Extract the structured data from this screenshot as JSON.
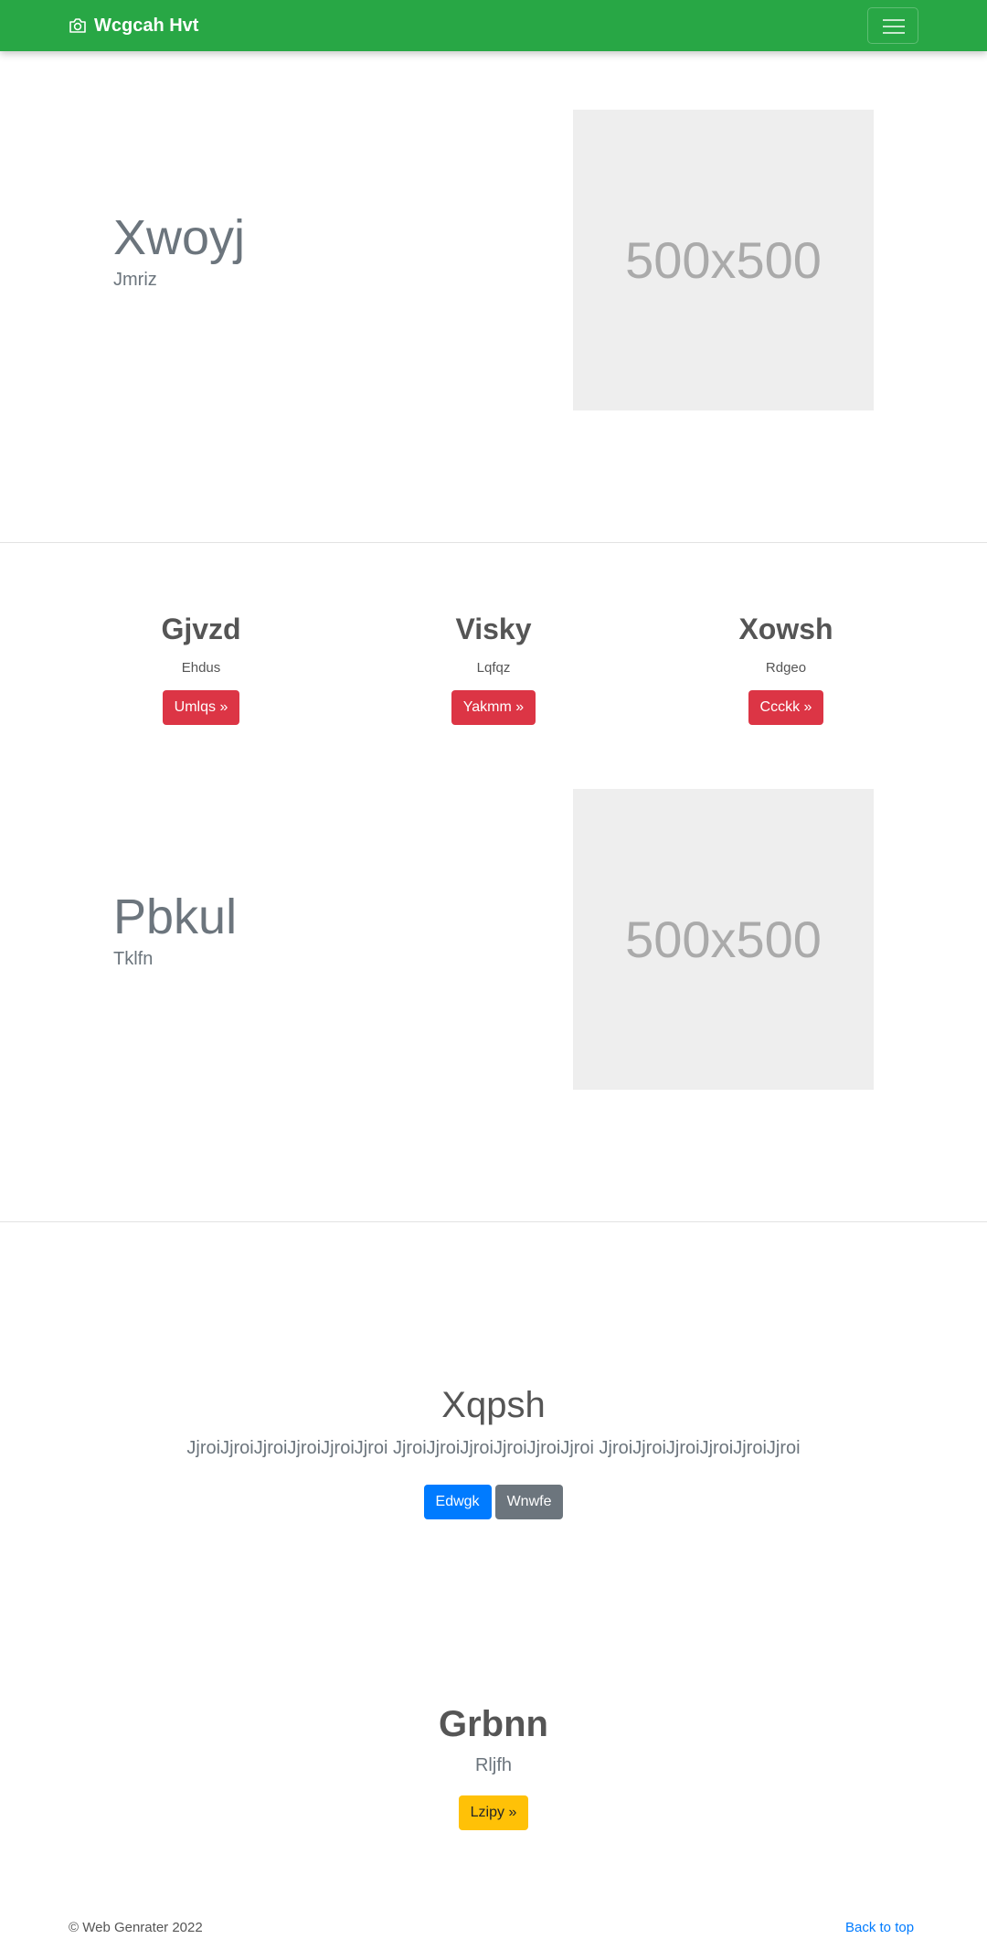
{
  "navbar": {
    "brand": "Wcgcah Hvt",
    "brand_icon": "camera-icon",
    "menu_icon": "hamburger-icon"
  },
  "feature1": {
    "title": "Xwoyj",
    "subtitle": "Jmriz",
    "image_text": "500x500"
  },
  "columns": [
    {
      "title": "Gjvzd",
      "text": "Ehdus",
      "button": "Umlqs »"
    },
    {
      "title": "Visky",
      "text": "Lqfqz",
      "button": "Yakmm »"
    },
    {
      "title": "Xowsh",
      "text": "Rdgeo",
      "button": "Ccckk »"
    }
  ],
  "feature2": {
    "title": "Pbkul",
    "subtitle": "Tklfn",
    "image_text": "500x500"
  },
  "jumbotron": {
    "title": "Xqpsh",
    "lead": "JjroiJjroiJjroiJjroiJjroiJjroi JjroiJjroiJjroiJjroiJjroiJjroi JjroiJjroiJjroiJjroiJjroiJjroi",
    "primary_button": "Edwgk",
    "secondary_button": "Wnwfe"
  },
  "cta": {
    "title": "Grbnn",
    "subtitle": "Rljfh",
    "button": "Lzipy »"
  },
  "footer": {
    "copyright": "© Web Genrater 2022",
    "back_to_top": "Back to top"
  },
  "colors": {
    "navbar": "#28a745",
    "danger": "#dc3545",
    "primary": "#007bff",
    "secondary": "#6c757d",
    "warning": "#ffc107"
  }
}
